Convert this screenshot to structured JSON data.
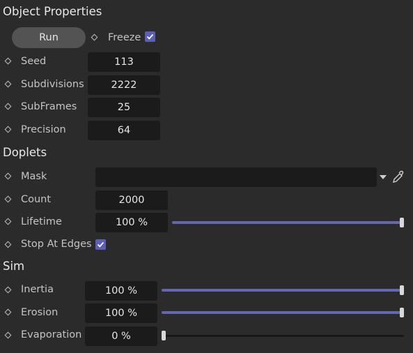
{
  "sections": {
    "object_properties": "Object Properties",
    "doplets": "Doplets",
    "sim": "Sim"
  },
  "object_properties": {
    "run_label": "Run",
    "freeze_label": "Freeze",
    "freeze_checked": true,
    "seed": {
      "label": "Seed",
      "value": "113"
    },
    "subdivisions": {
      "label": "Subdivisions",
      "value": "2222"
    },
    "subframes": {
      "label": "SubFrames",
      "value": "25"
    },
    "precision": {
      "label": "Precision",
      "value": "64"
    }
  },
  "doplets": {
    "mask": {
      "label": "Mask",
      "value": ""
    },
    "count": {
      "label": "Count",
      "value": "2000"
    },
    "lifetime": {
      "label": "Lifetime",
      "value": "100 %",
      "level": 1.0
    },
    "stop_at_edges": {
      "label": "Stop At Edges",
      "checked": true
    }
  },
  "sim": {
    "inertia": {
      "label": "Inertia",
      "value": "100 %",
      "level": 1.0
    },
    "erosion": {
      "label": "Erosion",
      "value": "100 %",
      "level": 1.0
    },
    "evaporation": {
      "label": "Evaporation",
      "value": "0 %",
      "level": 0.0
    }
  },
  "icons": {
    "keyframe": "keyframe-diamond-icon",
    "dropdown": "dropdown-arrow-icon",
    "picker": "eyedropper-icon",
    "checkbox": "checkmark-icon"
  },
  "colors": {
    "background": "#2b2b2b",
    "field": "#1b1b1b",
    "accent": "#5b5fb6",
    "slider_fill": "#6467b0"
  }
}
